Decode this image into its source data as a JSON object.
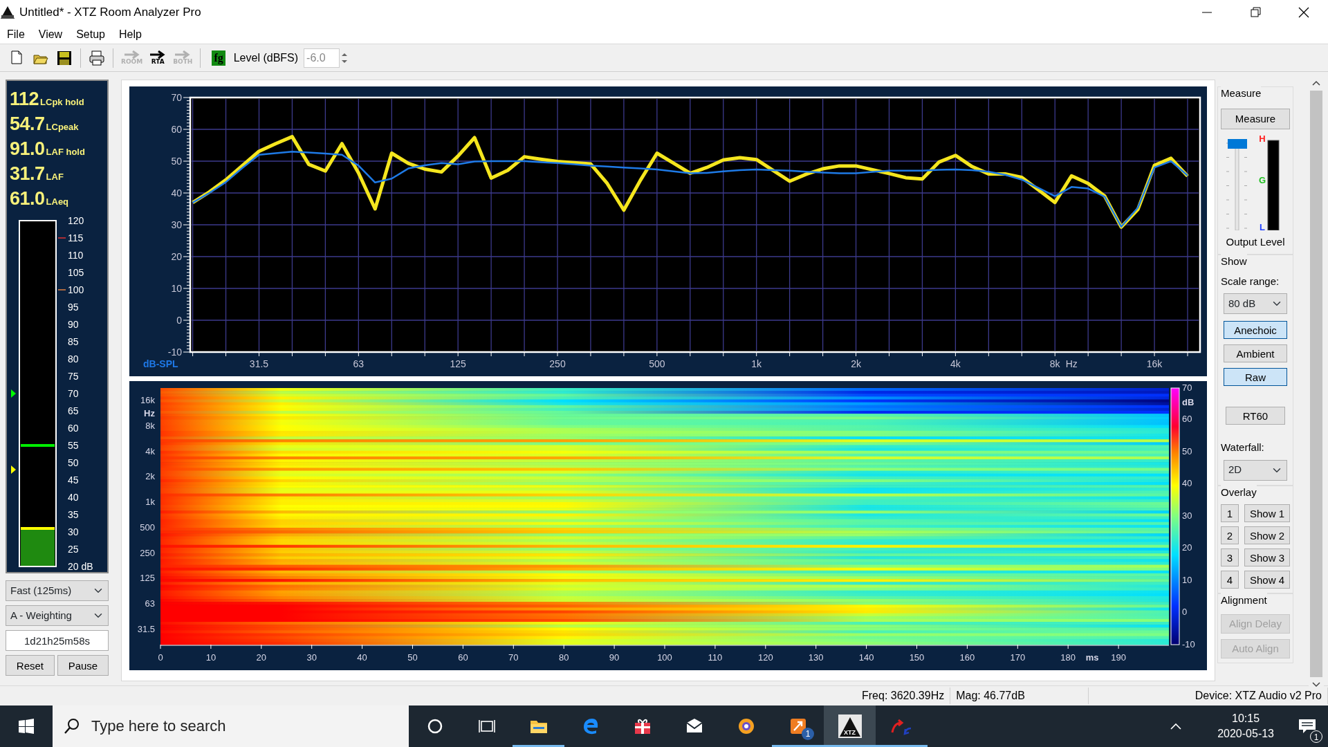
{
  "window": {
    "title": "Untitled* - XTZ Room Analyzer Pro"
  },
  "menu": [
    "File",
    "View",
    "Setup",
    "Help"
  ],
  "toolbar": {
    "buttons": [
      {
        "kind": "new"
      },
      {
        "kind": "open"
      },
      {
        "kind": "save"
      },
      {
        "kind": "print"
      },
      {
        "kind": "mode",
        "label": "ROOM",
        "disabled": true
      },
      {
        "kind": "mode",
        "label": "RTA",
        "disabled": false
      },
      {
        "kind": "mode",
        "label": "BOTH",
        "disabled": true
      }
    ],
    "generator": {
      "label": "fg"
    },
    "level_label": "Level (dBFS)",
    "level_value": "-6.0",
    "level_disabled": true
  },
  "meter": {
    "readings": [
      {
        "value": "112",
        "label": "LCpk hold"
      },
      {
        "value": "54.7",
        "label": "LCpeak"
      },
      {
        "value": "91.0",
        "label": "LAF hold"
      },
      {
        "value": "31.7",
        "label": "LAF"
      },
      {
        "value": "61.0",
        "label": "LAeq"
      }
    ],
    "scale": [
      "120",
      "115",
      "110",
      "105",
      "100",
      "95",
      "90",
      "85",
      "80",
      "75",
      "70",
      "65",
      "60",
      "55",
      "50",
      "45",
      "40",
      "35",
      "30",
      "25",
      "20 dB"
    ],
    "level": 0.11,
    "hold": {
      "level": 0.35
    },
    "markers": [
      {
        "level": 0.5,
        "color": "#00ff00"
      },
      {
        "level": 0.28,
        "color": "#ffff00"
      }
    ],
    "response": "Fast (125ms)",
    "weighting": "A - Weighting",
    "elapsed": "1d21h25m58s",
    "buttons": [
      "Reset",
      "Pause"
    ]
  },
  "frequency_chart": {
    "chart_data": {
      "type": "line",
      "xlabel": "Hz",
      "ylabel": "dB-SPL",
      "categories": [
        null,
        null,
        null,
        null,
        "31.5",
        null,
        null,
        null,
        null,
        null,
        "63",
        null,
        null,
        null,
        null,
        null,
        "125",
        null,
        null,
        null,
        null,
        null,
        "250",
        null,
        null,
        null,
        null,
        null,
        "500",
        null,
        null,
        null,
        null,
        null,
        "1k",
        null,
        null,
        null,
        null,
        null,
        "2k",
        null,
        null,
        null,
        null,
        null,
        "4k",
        null,
        null,
        null,
        null,
        null,
        "8k",
        null,
        null,
        null,
        null,
        null,
        "16k",
        null,
        null
      ],
      "series": [
        {
          "color": "#f5e61e",
          "values": [
            37,
            40.3,
            44.1,
            48.6,
            53.1,
            55.5,
            57.7,
            49,
            46.9,
            55.5,
            46.3,
            35,
            52.5,
            49.3,
            47.5,
            46.6,
            51.6,
            57.4,
            44.7,
            47.1,
            51.4,
            50.6,
            49.9,
            49.5,
            49.1,
            43,
            34.6,
            44,
            52.5,
            49.4,
            46.2,
            48,
            50.4,
            51.1,
            50.5,
            47.1,
            43.7,
            45.9,
            47.6,
            48.5,
            48.5,
            47.3,
            46.1,
            44.8,
            44.4,
            49.7,
            51.8,
            48.3,
            46,
            46,
            44.9,
            41,
            37,
            45.4,
            43,
            39,
            29.3,
            34.8,
            48.7,
            50.9,
            45.3
          ]
        },
        {
          "color": "#1e7ae6",
          "values": [
            37,
            40,
            43.4,
            47.9,
            52,
            52.5,
            53,
            52.7,
            52.4,
            52,
            48.6,
            43.3,
            44.5,
            47.7,
            48.7,
            49.4,
            49,
            49.9,
            50,
            50,
            50,
            49.7,
            49.4,
            49,
            48.6,
            48.3,
            48,
            47.7,
            47.4,
            46.8,
            46.2,
            46.3,
            46.8,
            47.2,
            47.4,
            47.2,
            47,
            46.7,
            46.4,
            46.2,
            46.2,
            46.6,
            47,
            47,
            47,
            47.3,
            47.4,
            47.2,
            46.7,
            45.7,
            44.2,
            41.6,
            39,
            41.9,
            41.4,
            38.8,
            29.4,
            35.4,
            48,
            50,
            45.5
          ]
        }
      ],
      "ylim": [
        -10,
        70
      ],
      "grid": true,
      "yticks": [
        -10,
        0,
        10,
        20,
        30,
        40,
        50,
        60,
        70
      ]
    }
  },
  "spectrogram": {
    "freq_ticks": [
      "16k",
      "8k",
      "4k",
      "2k",
      "1k",
      "500",
      "250",
      "125",
      "63",
      "31.5"
    ],
    "freq_unit": "Hz",
    "time_ticks": [
      "0",
      "10",
      "20",
      "30",
      "40",
      "50",
      "60",
      "70",
      "80",
      "90",
      "100",
      "110",
      "120",
      "130",
      "140",
      "150",
      "160",
      "170",
      "180",
      "190"
    ],
    "time_unit": "ms",
    "scale_ticks": [
      "70",
      "60",
      "50",
      "40",
      "30",
      "20",
      "10",
      "0",
      "-10"
    ],
    "scale_unit": "dB"
  },
  "side_panel": {
    "measure": {
      "title": "Measure",
      "button": "Measure",
      "output_level": {
        "level": 1.0
      },
      "meter_labels": [
        "H",
        "G",
        "L"
      ],
      "caption": "Output Level"
    },
    "show": {
      "title": "Show",
      "scale_label": "Scale range:",
      "scale_value": "80 dB",
      "views": [
        {
          "label": "Anechoic",
          "selected": true
        },
        {
          "label": "Ambient",
          "selected": false
        },
        {
          "label": "Raw",
          "selected": true
        }
      ],
      "rt60": "RT60",
      "waterfall_label": "Waterfall:",
      "waterfall_value": "2D"
    },
    "overlay": {
      "title": "Overlay",
      "rows": [
        {
          "number": "1",
          "label": "Show 1"
        },
        {
          "number": "2",
          "label": "Show 2"
        },
        {
          "number": "3",
          "label": "Show 3"
        },
        {
          "number": "4",
          "label": "Show 4"
        }
      ]
    },
    "alignment": {
      "title": "Alignment",
      "buttons": [
        {
          "label": "Align Delay",
          "disabled": true
        },
        {
          "label": "Auto Align",
          "disabled": true
        }
      ]
    }
  },
  "status_bar": {
    "freq": "Freq: 3620.39Hz",
    "mag": "Mag: 46.77dB",
    "device": "Device: XTZ Audio v2 Pro"
  },
  "taskbar": {
    "search_placeholder": "Type here to search",
    "apps": [
      {
        "kind": "cortana",
        "running": false
      },
      {
        "kind": "taskview",
        "running": false
      },
      {
        "kind": "explorer",
        "running": true
      },
      {
        "kind": "edge",
        "running": false
      },
      {
        "kind": "gift",
        "running": false
      },
      {
        "kind": "mail",
        "running": false
      },
      {
        "kind": "browser",
        "running": false
      },
      {
        "kind": "app",
        "badge": "1",
        "running": true
      },
      {
        "kind": "xtz",
        "label": "XTZ",
        "running": true,
        "active": true
      },
      {
        "kind": "analyzer",
        "running": true
      }
    ],
    "time": "10:15",
    "date": "2020-05-13",
    "notification_badge": "1"
  }
}
